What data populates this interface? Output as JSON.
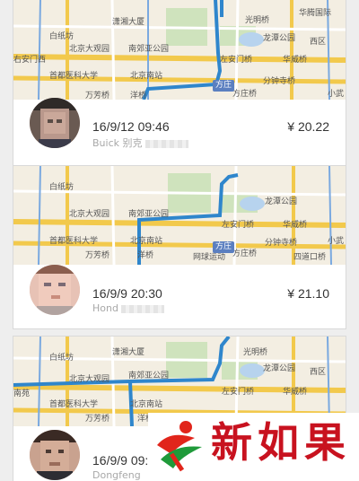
{
  "trips": [
    {
      "date_time": "16/9/12 09:46",
      "car": "Buick 别克",
      "price": "¥ 20.22",
      "map_labels": {
        "l1": "潇湘大厦",
        "l2": "光明桥",
        "l3": "华腾国际",
        "l4": "白纸坊",
        "l5": "龙潭公园",
        "l6": "北京大观园",
        "l7": "南郊亚公园",
        "l8": "西区",
        "l9": "右安门西",
        "l10": "左安门桥",
        "l11": "华威桥",
        "l12": "首都医科大学",
        "l13": "北京南站",
        "l14": "分钟寺桥",
        "l15": "万芳桥",
        "l16": "洋桥",
        "l17": "方庄桥",
        "l18": "小武"
      },
      "badge": "方庄"
    },
    {
      "date_time": "16/9/9 20:30",
      "car": "Hond",
      "price": "¥ 21.10",
      "map_labels": {
        "l1": "白纸坊",
        "l2": "龙潭公园",
        "l3": "北京大观园",
        "l4": "南郊亚公园",
        "l5": "左安门桥",
        "l6": "首都医科大学",
        "l7": "北京南站",
        "l8": "华威桥",
        "l9": "万芳桥",
        "l10": "方庄桥",
        "l11": "分钟寺桥",
        "l12": "洋桥",
        "l13": "网球运动",
        "l14": "四道口桥",
        "l15": "小武"
      },
      "badge": "方庄"
    },
    {
      "date_time": "16/9/9 09:5",
      "car": "Dongfeng",
      "price": "",
      "map_labels": {
        "l1": "白纸坊",
        "l2": "潇湘大厦",
        "l3": "光明桥",
        "l4": "北京大观园",
        "l5": "南郊亚公园",
        "l6": "龙潭公园",
        "l7": "左安门桥",
        "l8": "西区",
        "l9": "首都医科大学",
        "l10": "北京南站",
        "l11": "华威桥",
        "l12": "万芳桥",
        "l13": "洋桥",
        "l14": "南苑"
      },
      "badge": ""
    }
  ],
  "watermark": {
    "logo_text": "新如果"
  },
  "colors": {
    "route": "#2f86cc",
    "road_yellow": "#f2c94c",
    "map_bg": "#f3eee2",
    "park": "#cfe3bd",
    "water": "#b7d3ee"
  }
}
